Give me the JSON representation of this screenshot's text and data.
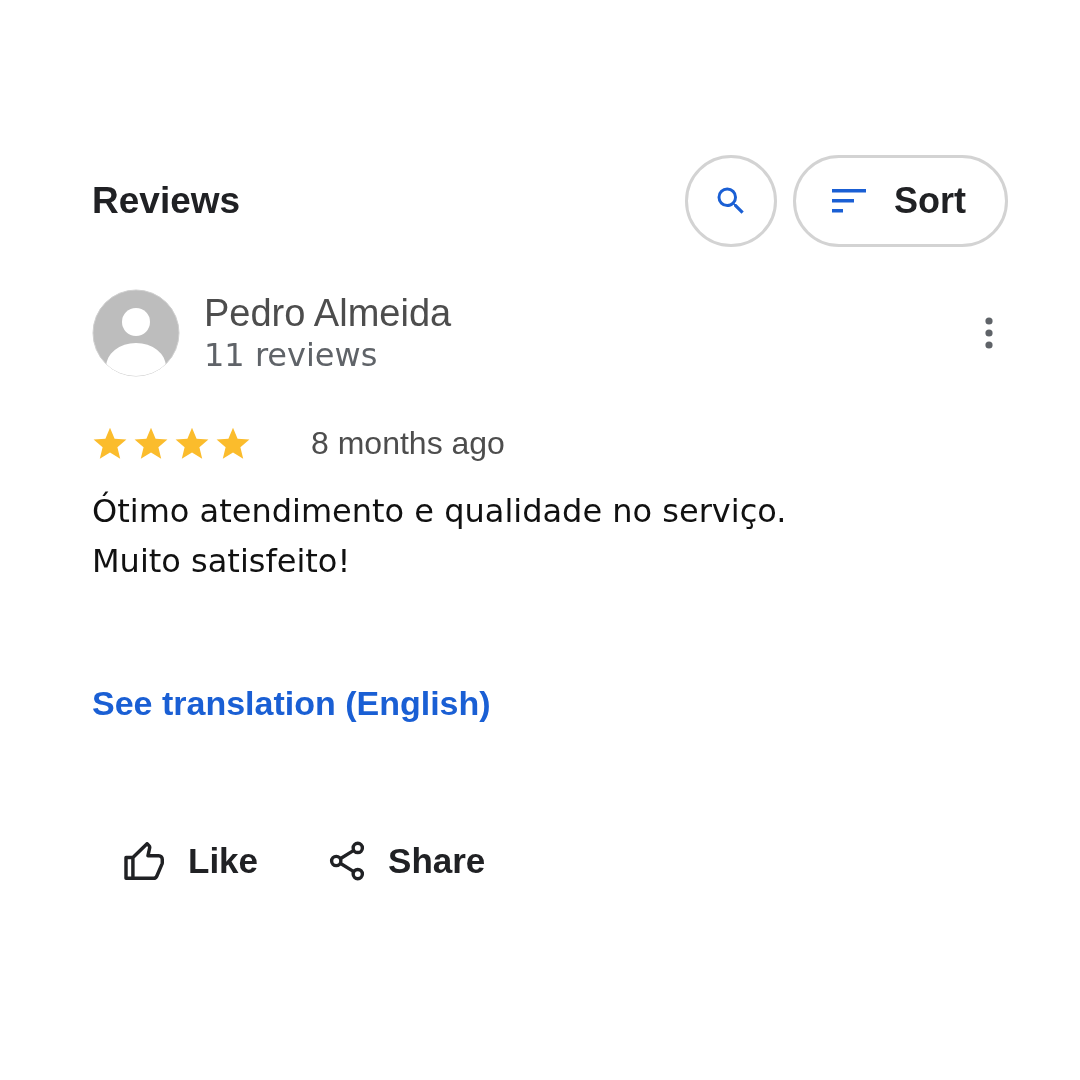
{
  "header": {
    "title": "Reviews",
    "sort_label": "Sort"
  },
  "review": {
    "author": "Pedro Almeida",
    "meta": "11 reviews",
    "stars": 4,
    "time": "8 months ago",
    "text_lines": [
      "Ótimo atendimento e qualidade no serviço.",
      "Muito satisfeito!"
    ],
    "translation_link": "See translation (English)",
    "actions": [
      {
        "kind": "like",
        "label": "Like"
      },
      {
        "kind": "share",
        "label": "Share"
      }
    ]
  }
}
